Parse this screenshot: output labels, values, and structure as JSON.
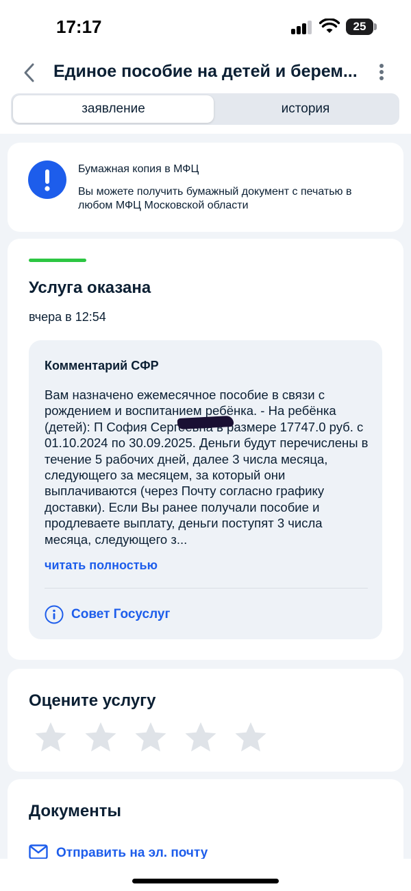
{
  "status_bar": {
    "time": "17:17",
    "battery": "25"
  },
  "header": {
    "title": "Единое пособие на детей и берем...",
    "back_icon": "chevron-left-icon",
    "more_icon": "more-vertical-icon"
  },
  "tabs": [
    {
      "label": "заявление",
      "active": true
    },
    {
      "label": "история",
      "active": false
    }
  ],
  "mfc_notice": {
    "icon": "exclamation-icon",
    "title": "Бумажная копия в МФЦ",
    "text": "Вы можете получить бумажный документ с печатью в любом МФЦ Московской области"
  },
  "status": {
    "heading": "Услуга оказана",
    "date": "вчера в 12:54",
    "comment": {
      "title": "Комментарий СФР",
      "text": "Вам назначено ежемесячное пособие в связи с рождением и воспитанием ребёнка. - На ребёнка (детей): П           София Сергеевна в размере 17747.0 руб. с 01.10.2024 по 30.09.2025. Деньги будут перечислены в течение 5 рабочих дней, далее 3 числа месяца, следующего за месяцем, за который они выплачиваются (через Почту согласно графику доставки). Если Вы ранее получали пособие и продлеваете выплату, деньги поступят 3 числа месяца, следующего з...",
      "read_more": "читать полностью",
      "advice_label": "Совет Госуслуг"
    }
  },
  "rating": {
    "heading": "Оцените услугу",
    "stars_total": 5,
    "stars_selected": 0
  },
  "documents": {
    "heading": "Документы",
    "send_email": "Отправить на эл. почту"
  },
  "colors": {
    "accent": "#1d5deb",
    "success": "#2cc642",
    "text": "#0b1f33",
    "background": "#f1f4f8"
  }
}
